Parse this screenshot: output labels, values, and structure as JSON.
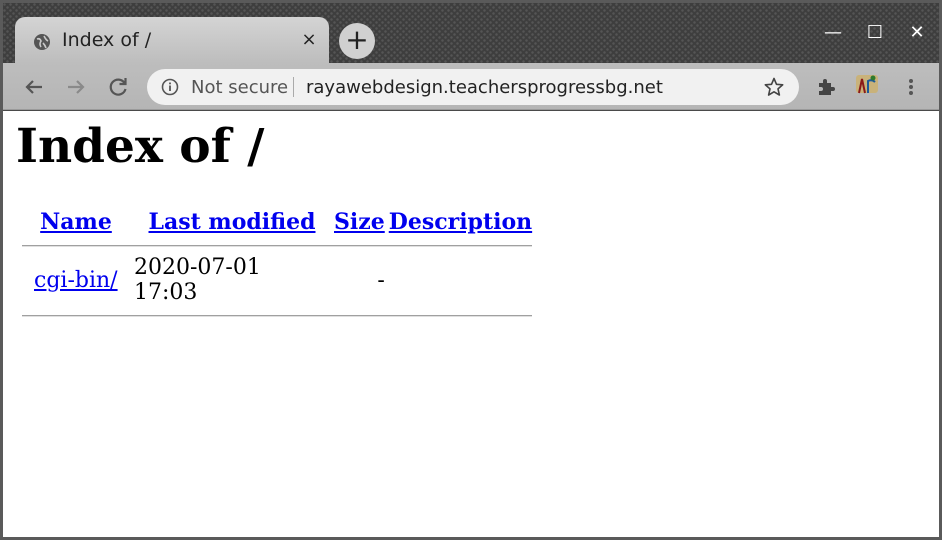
{
  "browser": {
    "tab_title": "Index of /",
    "tab_close": "×",
    "new_tab": "+",
    "window_controls": {
      "minimize": "—",
      "maximize": "☐",
      "close": "✕"
    },
    "security_label": "Not secure",
    "url": "rayawebdesign.teachersprogressbg.net",
    "icons": [
      "globe-icon",
      "back-icon",
      "forward-icon",
      "reload-icon",
      "info-icon",
      "star-icon",
      "extensions-icon",
      "profile-icon",
      "menu-icon"
    ]
  },
  "page": {
    "heading": "Index of /",
    "columns": [
      {
        "label": "Name"
      },
      {
        "label": "Last modified"
      },
      {
        "label": "Size"
      },
      {
        "label": "Description"
      }
    ],
    "rows": [
      {
        "name": "cgi-bin/",
        "modified": "2020-07-01 17:03",
        "size": "-",
        "description": ""
      }
    ]
  },
  "colors": {
    "link": "#0000ee",
    "titlebar": "#3e3e3e",
    "toolbar": "#bdbdbd"
  }
}
